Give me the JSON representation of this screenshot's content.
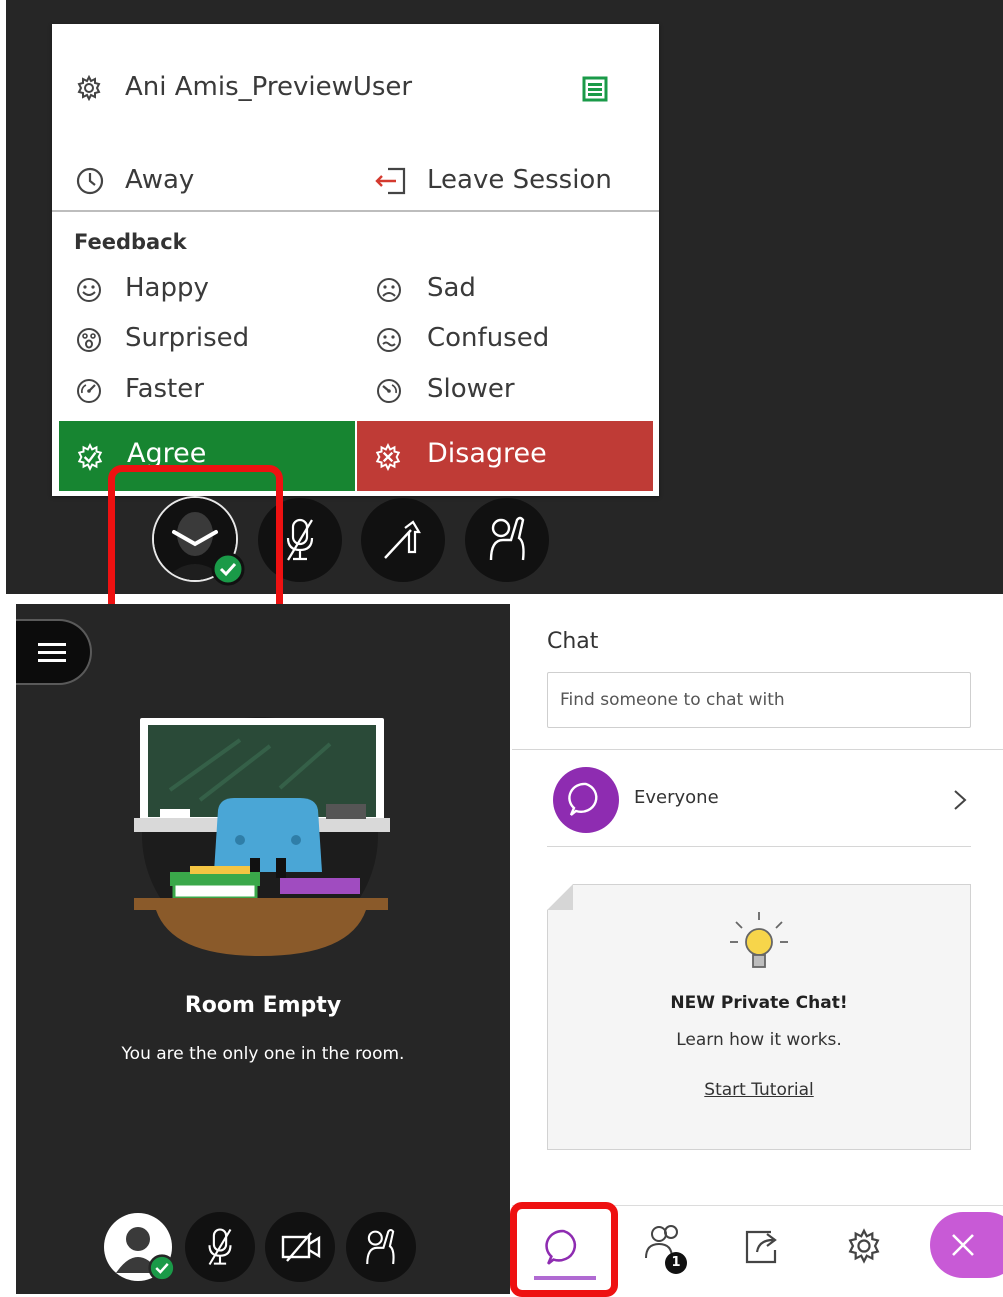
{
  "menu": {
    "user_name": "Ani Amis_PreviewUser",
    "away_label": "Away",
    "leave_label": "Leave Session",
    "feedback_heading": "Feedback",
    "feedback": {
      "happy": "Happy",
      "sad": "Sad",
      "surprised": "Surprised",
      "confused": "Confused",
      "faster": "Faster",
      "slower": "Slower"
    },
    "agree_label": "Agree",
    "disagree_label": "Disagree",
    "colors": {
      "agree": "#178531",
      "disagree": "#bf3b36",
      "accent_green": "#1a9a48"
    }
  },
  "controls_top": {
    "icons": [
      "avatar-with-status",
      "mic-off-icon",
      "share-content-icon",
      "raise-hand-icon"
    ]
  },
  "room": {
    "title": "Room Empty",
    "subtitle": "You are the only one in the room."
  },
  "chat": {
    "title": "Chat",
    "search_placeholder": "Find someone to chat with",
    "everyone_label": "Everyone",
    "tutorial": {
      "title": "NEW Private Chat!",
      "subtitle": "Learn how it works.",
      "link": "Start Tutorial"
    },
    "tabs": {
      "attendees_badge": "1"
    },
    "colors": {
      "accent": "#8e2cb1",
      "close": "#c85ad6"
    }
  },
  "highlight_color": "#ee1111"
}
